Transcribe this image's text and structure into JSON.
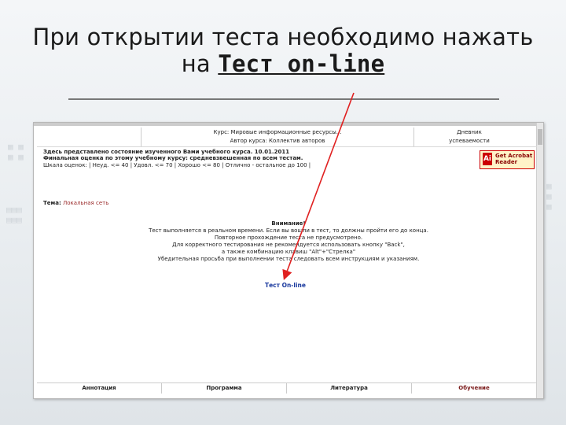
{
  "slide": {
    "title_line1": "При открытии теста необходимо нажать",
    "title_line2_prefix": "на ",
    "title_line2_emphasis": "Тест on-line"
  },
  "screen": {
    "header_course": "Курс: Мировые информационные ресурсы...",
    "header_author": "Автор курса: Коллектив авторов",
    "header_diary": "Дневник",
    "header_progress": "успеваемости",
    "info_line1": "Здесь представлено состояние изученного Вами учебного курса. 10.01.2011",
    "info_line2": "Финальная оценка по этому учебному курсу: средневзвешенная по всем тестам.",
    "info_line3": "Шкала оценок: | Неуд. <= 40 | Удовл. <= 70 | Хорошо <= 80 | Отлично - остальное до 100 |",
    "acrobat_line1": "Get Acrobat",
    "acrobat_line2": "Reader",
    "acrobat_icon": "Ai",
    "tema_label": "Тема:",
    "tema_value": "Локальная сеть",
    "notice_title": "Внимание!",
    "notice_line1": "Тест выполняется в реальном времени. Если вы вошли в тест, то должны пройти его до конца.",
    "notice_line2": "Повторное прохождение теста не предусмотрено.",
    "notice_line3": "Для корректного тестирования не рекомендуется использовать кнопку \"Back\",",
    "notice_line4": "а также комбинацию клавиш \"Alt\"+\"Стрелка\"",
    "notice_line5": "Убедительная просьба при выполнении теста следовать всем инструкциям и указаниям.",
    "test_link": "Тест On-line",
    "footer": {
      "annotation": "Аннотация",
      "program": "Программа",
      "literature": "Литература",
      "training": "Обучение"
    }
  },
  "colors": {
    "arrow": "#e02020",
    "link": "#1b3a9e"
  }
}
